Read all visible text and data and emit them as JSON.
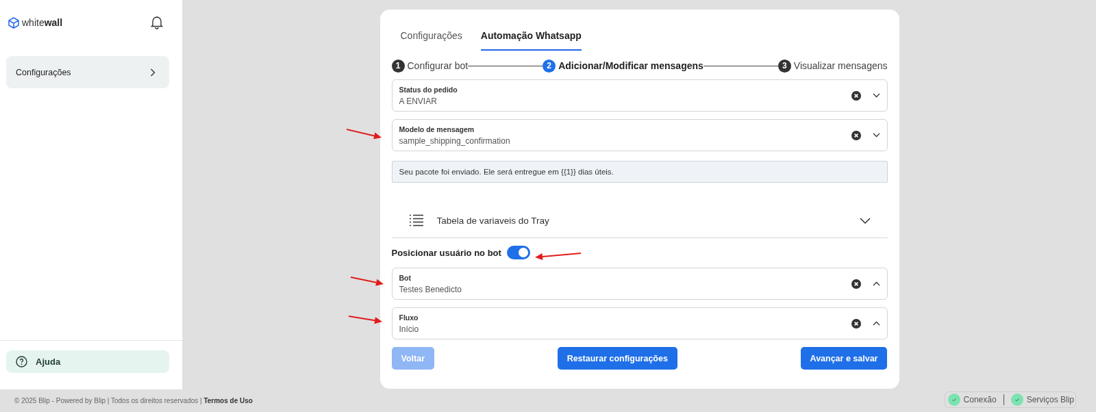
{
  "sidebar": {
    "logo": {
      "light": "white",
      "bold": "wall"
    },
    "items": [
      {
        "label": "Configurações"
      }
    ],
    "help": "Ajuda"
  },
  "tabs": [
    {
      "label": "Configurações",
      "selected": false
    },
    {
      "label": "Automação Whatsapp",
      "selected": true
    }
  ],
  "steps": [
    {
      "number": "1",
      "label": "Configurar bot",
      "selected": false
    },
    {
      "number": "2",
      "label": "Adicionar/Modificar mensagens",
      "selected": true
    },
    {
      "number": "3",
      "label": "Visualizar mensagens",
      "selected": false
    }
  ],
  "fields": [
    {
      "label": "Status do pedido",
      "value": "A ENVIAR",
      "expanded": false
    },
    {
      "label": "Modelo de mensagem",
      "value": "sample_shipping_confirmation",
      "expanded": false
    }
  ],
  "message_preview": "Seu pacote foi enviado. Ele será entregue em {{1}} dias úteis.",
  "accordion": {
    "title": "Tabela de variaveis do Tray",
    "expanded": false
  },
  "toggle": {
    "label": "Posicionar usuário no bot",
    "on": true
  },
  "bot_fields": [
    {
      "label": "Bot",
      "value": "Testes Benedicto",
      "expanded": true
    },
    {
      "label": "Fluxo",
      "value": "Início",
      "expanded": true
    }
  ],
  "buttons": [
    {
      "label": "Voltar",
      "disabled": true
    },
    {
      "label": "Restaurar configurações",
      "disabled": false
    },
    {
      "label": "Avançar e salvar",
      "disabled": false
    }
  ],
  "footer": {
    "copyright": "© 2025 Blip - Powered by Blip | Todos os direitos reservados |",
    "link": "Termos de Uso"
  },
  "status": [
    {
      "label": "Conexão"
    },
    {
      "label": "Serviços Blip"
    }
  ]
}
